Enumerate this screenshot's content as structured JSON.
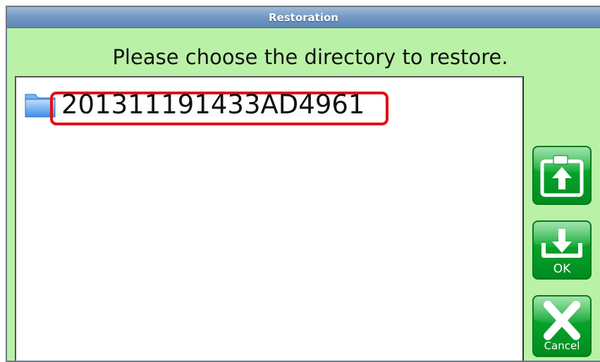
{
  "window": {
    "title": "Restoration"
  },
  "prompt": {
    "text": "Please choose the directory to restore."
  },
  "directory_list": {
    "items": [
      {
        "label": "201311191433AD4961",
        "icon": "folder-icon",
        "highlighted": true
      }
    ]
  },
  "side_buttons": {
    "backup": {
      "label": "",
      "icon": "restore-upload-icon"
    },
    "ok": {
      "label": "OK",
      "icon": "download-tray-icon"
    },
    "cancel": {
      "label": "Cancel",
      "icon": "close-x-icon"
    }
  },
  "colors": {
    "background": "#b9f2a7",
    "titlebar": "#6f95bf",
    "button_green": "#06a22a",
    "highlight_red": "#e0101a"
  }
}
